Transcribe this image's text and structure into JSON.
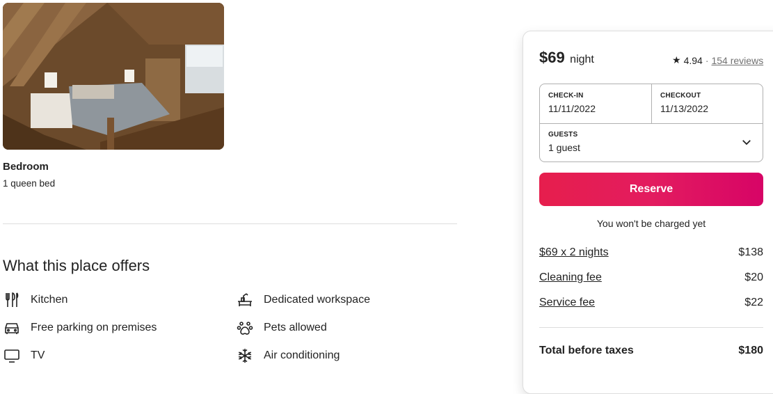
{
  "room": {
    "photo_alt": "Loft bedroom with wooden walls and queen bed",
    "name": "Bedroom",
    "beds": "1 queen bed"
  },
  "offers": {
    "title": "What this place offers",
    "items": [
      {
        "icon": "kitchen-icon",
        "label": "Kitchen"
      },
      {
        "icon": "workspace-icon",
        "label": "Dedicated workspace"
      },
      {
        "icon": "car-icon",
        "label": "Free parking on premises"
      },
      {
        "icon": "paw-icon",
        "label": "Pets allowed"
      },
      {
        "icon": "tv-icon",
        "label": "TV"
      },
      {
        "icon": "snowflake-icon",
        "label": "Air conditioning"
      }
    ]
  },
  "booking": {
    "price": "$69",
    "price_unit": "night",
    "rating": "4.94",
    "separator": "·",
    "reviews": "154 reviews",
    "checkin_label": "CHECK-IN",
    "checkin_value": "11/11/2022",
    "checkout_label": "CHECKOUT",
    "checkout_value": "11/13/2022",
    "guests_label": "GUESTS",
    "guests_value": "1 guest",
    "reserve_label": "Reserve",
    "no_charge_note": "You won't be charged yet",
    "line_items": [
      {
        "label": "$69 x 2 nights",
        "amount": "$138"
      },
      {
        "label": "Cleaning fee",
        "amount": "$20"
      },
      {
        "label": "Service fee",
        "amount": "$22"
      }
    ],
    "total_label": "Total before taxes",
    "total_amount": "$180",
    "accent_color": "#e31c5f"
  }
}
